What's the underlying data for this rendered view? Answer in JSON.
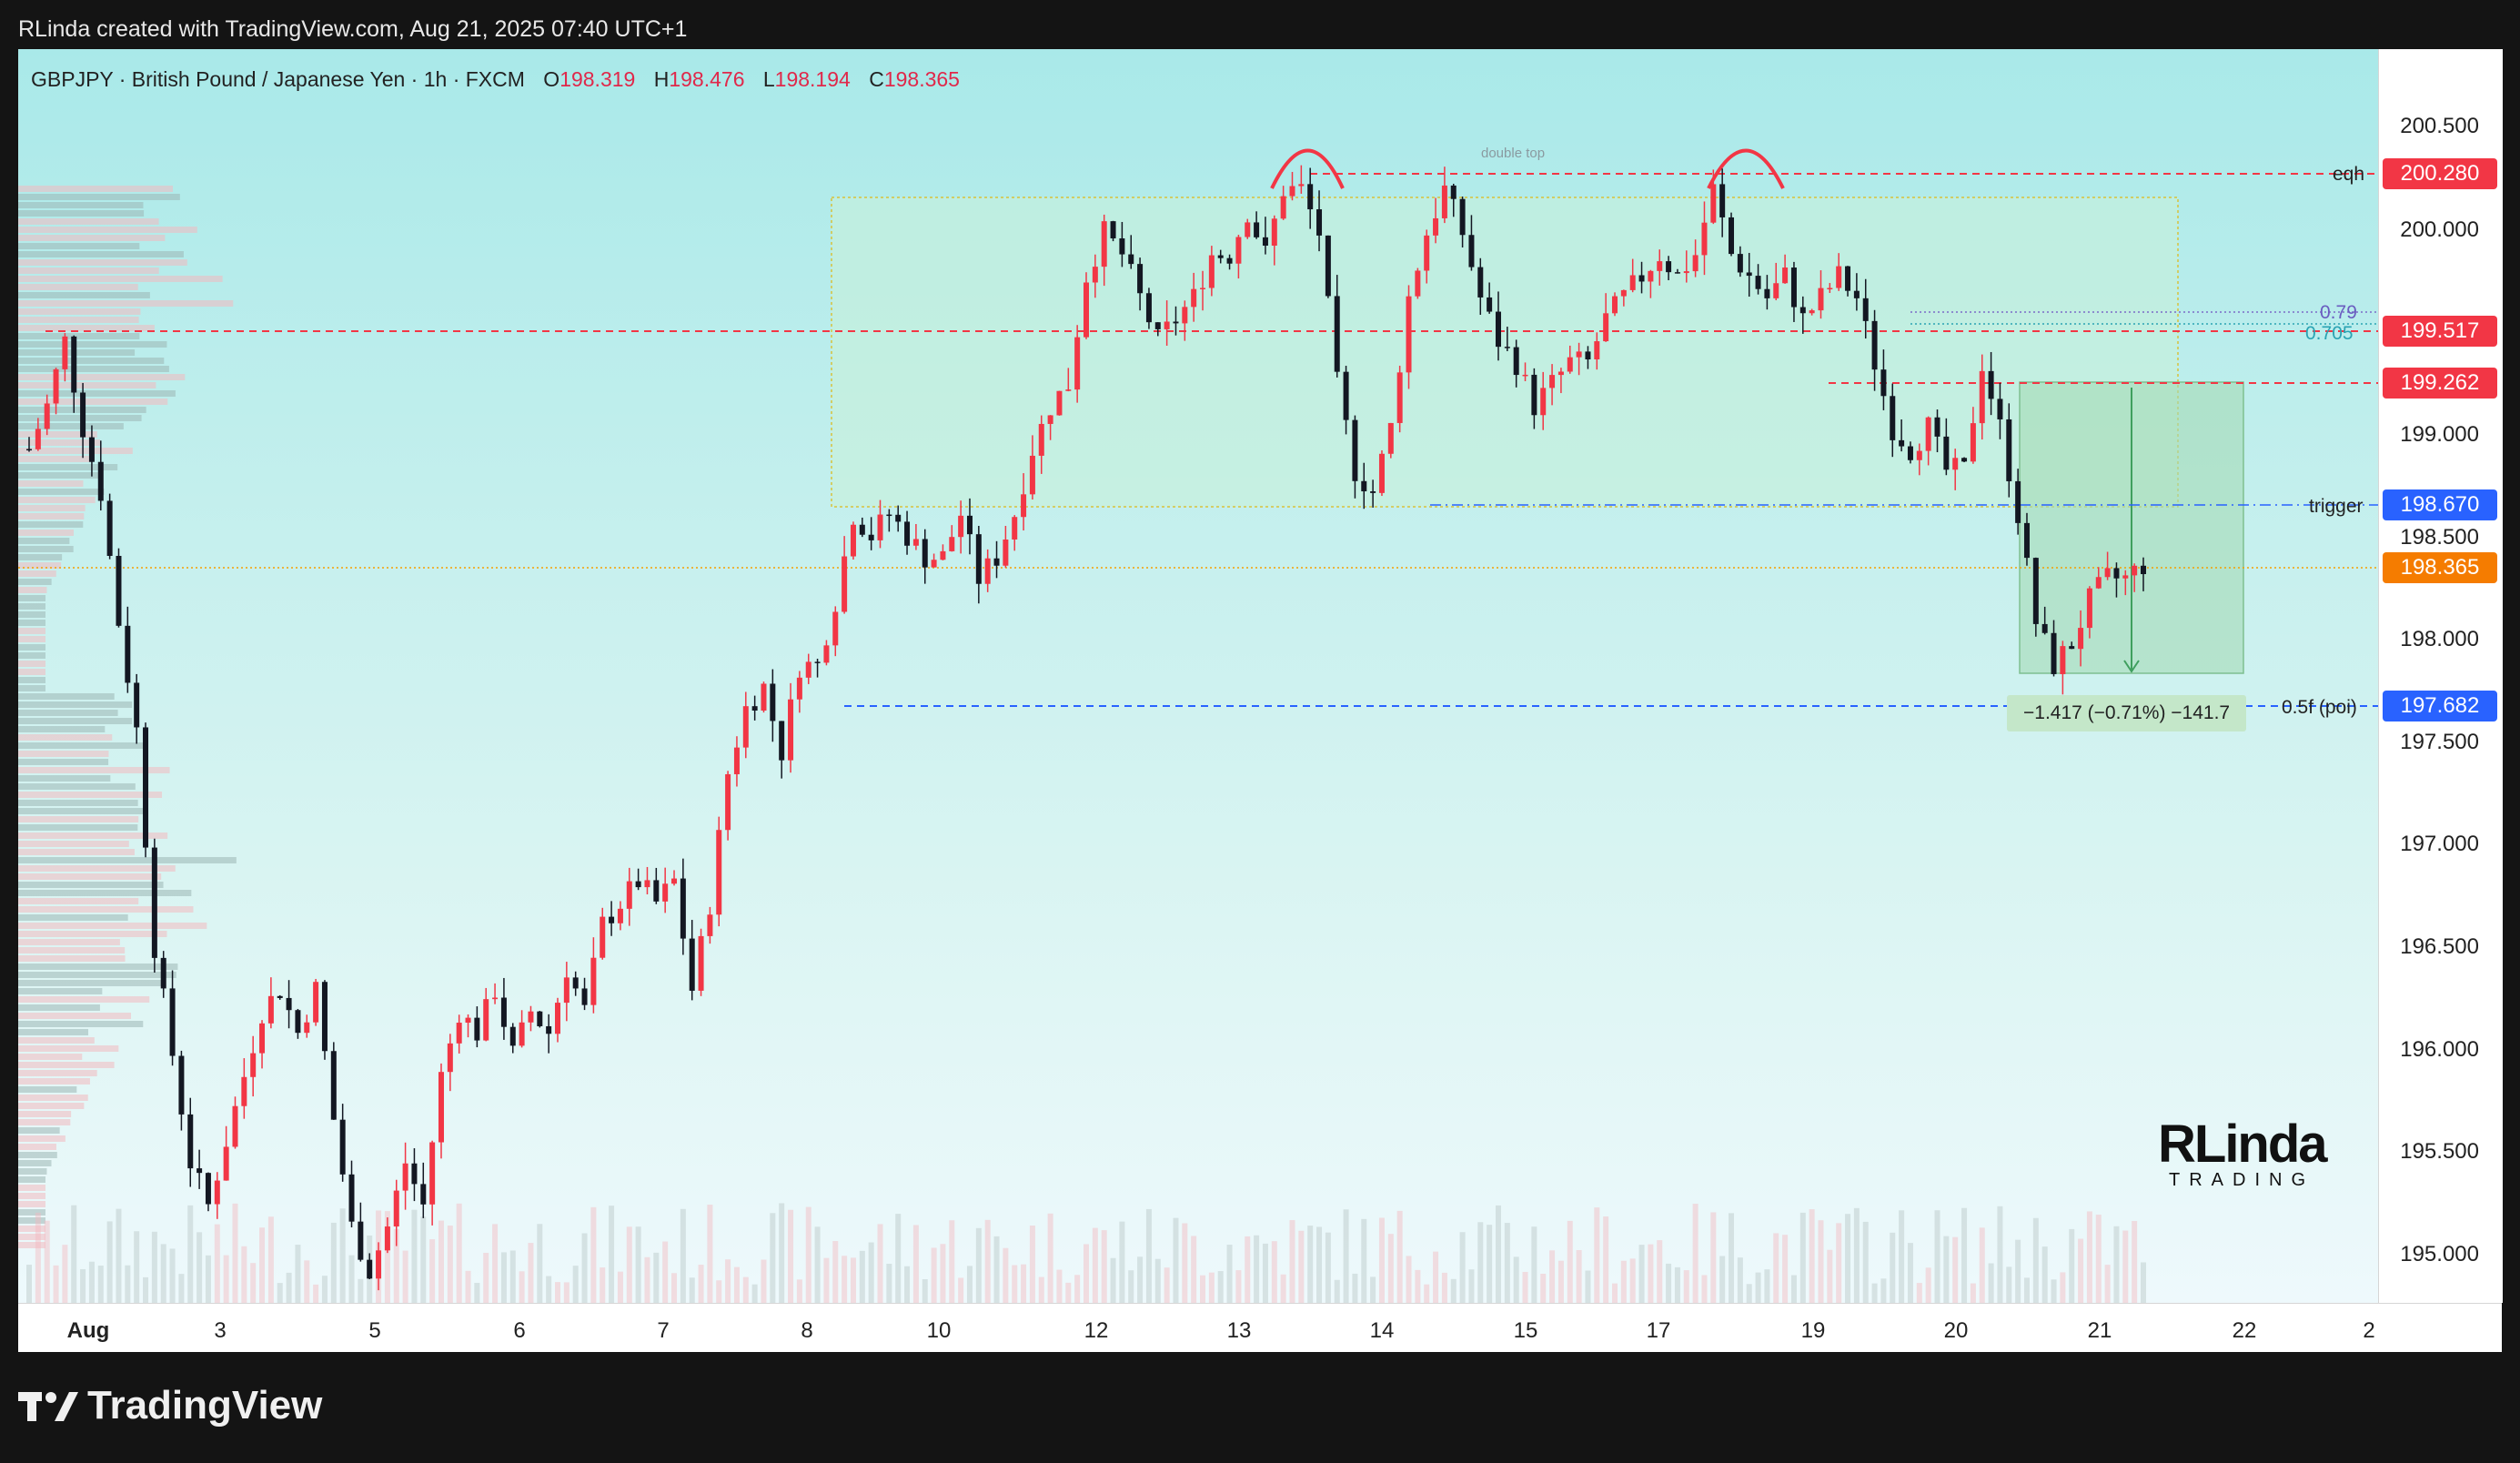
{
  "credit": "RLinda created with TradingView.com, Aug 21, 2025 07:40 UTC+1",
  "legend": {
    "symbol": "GBPJPY · British Pound / Japanese Yen · 1h · FXCM",
    "o_label": "O",
    "o": "198.319",
    "h_label": "H",
    "h": "198.476",
    "l_label": "L",
    "l": "198.194",
    "c_label": "C",
    "c": "198.365"
  },
  "price_axis": {
    "ticks": [
      "200.500",
      "200.000",
      "199.000",
      "198.500",
      "198.000",
      "197.500",
      "197.000",
      "196.500",
      "196.000",
      "195.500",
      "195.000"
    ],
    "tags": [
      {
        "text": "200.280",
        "color": "#f23645"
      },
      {
        "text": "199.517",
        "color": "#f23645"
      },
      {
        "text": "199.262",
        "color": "#f23645"
      },
      {
        "text": "198.670",
        "color": "#2962ff"
      },
      {
        "text": "198.365",
        "color": "#f57c00"
      },
      {
        "text": "197.682",
        "color": "#2962ff"
      }
    ]
  },
  "time_axis": [
    "Aug",
    "3",
    "5",
    "6",
    "7",
    "8",
    "10",
    "12",
    "13",
    "14",
    "15",
    "17",
    "19",
    "20",
    "21",
    "22",
    "2"
  ],
  "line_labels": {
    "eqh": "eqh",
    "fib_079": "0.79",
    "fib_0705": "0.705",
    "trigger": "trigger",
    "poi": "0.5f (poi)",
    "double_top": "double top"
  },
  "position_stats": "−1.417 (−0.71%) −141.7",
  "logo": {
    "big": "RLinda",
    "small": "TRADING"
  },
  "footer": {
    "brand": "TradingView"
  },
  "colors": {
    "bull": "#f23645",
    "bear": "#131722",
    "accent_blue": "#2962ff",
    "accent_orange": "#f57c00"
  },
  "chart_data": {
    "type": "candlestick",
    "symbol": "GBPJPY",
    "timeframe": "1h",
    "ylim": [
      194.95,
      200.75
    ],
    "price_path": [
      [
        0,
        198.9
      ],
      [
        2,
        199.1
      ],
      [
        4,
        199.4
      ],
      [
        6,
        199.0
      ],
      [
        8,
        198.7
      ],
      [
        10,
        198.1
      ],
      [
        12,
        197.6
      ],
      [
        14,
        196.6
      ],
      [
        16,
        196.1
      ],
      [
        18,
        195.6
      ],
      [
        20,
        195.4
      ],
      [
        22,
        195.7
      ],
      [
        24,
        196.0
      ],
      [
        26,
        196.3
      ],
      [
        28,
        196.4
      ],
      [
        30,
        196.2
      ],
      [
        32,
        196.4
      ],
      [
        34,
        195.8
      ],
      [
        36,
        195.3
      ],
      [
        38,
        195.1
      ],
      [
        40,
        195.3
      ],
      [
        42,
        195.6
      ],
      [
        44,
        195.4
      ],
      [
        46,
        196.0
      ],
      [
        48,
        196.3
      ],
      [
        50,
        196.2
      ],
      [
        52,
        196.4
      ],
      [
        54,
        196.1
      ],
      [
        56,
        196.3
      ],
      [
        58,
        196.2
      ],
      [
        60,
        196.5
      ],
      [
        62,
        196.3
      ],
      [
        64,
        196.7
      ],
      [
        66,
        196.8
      ],
      [
        68,
        196.9
      ],
      [
        70,
        196.8
      ],
      [
        72,
        196.9
      ],
      [
        74,
        196.4
      ],
      [
        76,
        196.8
      ],
      [
        78,
        197.4
      ],
      [
        80,
        197.7
      ],
      [
        82,
        197.8
      ],
      [
        84,
        197.5
      ],
      [
        86,
        197.9
      ],
      [
        88,
        197.9
      ],
      [
        90,
        198.2
      ],
      [
        92,
        198.6
      ],
      [
        94,
        198.5
      ],
      [
        96,
        198.6
      ],
      [
        98,
        198.5
      ],
      [
        100,
        198.4
      ],
      [
        102,
        198.4
      ],
      [
        104,
        198.6
      ],
      [
        106,
        198.3
      ],
      [
        108,
        198.4
      ],
      [
        110,
        198.6
      ],
      [
        112,
        198.9
      ],
      [
        114,
        199.1
      ],
      [
        116,
        199.2
      ],
      [
        118,
        199.7
      ],
      [
        120,
        199.9
      ],
      [
        122,
        199.8
      ],
      [
        124,
        199.6
      ],
      [
        126,
        199.4
      ],
      [
        128,
        199.5
      ],
      [
        130,
        199.6
      ],
      [
        132,
        199.8
      ],
      [
        134,
        199.8
      ],
      [
        136,
        200.0
      ],
      [
        138,
        199.8
      ],
      [
        140,
        200.1
      ],
      [
        142,
        200.1
      ],
      [
        144,
        199.9
      ],
      [
        146,
        199.2
      ],
      [
        148,
        198.8
      ],
      [
        150,
        198.7
      ],
      [
        152,
        199.0
      ],
      [
        154,
        199.6
      ],
      [
        156,
        199.9
      ],
      [
        158,
        200.1
      ],
      [
        160,
        199.9
      ],
      [
        162,
        199.6
      ],
      [
        164,
        199.4
      ],
      [
        166,
        199.3
      ],
      [
        168,
        199.1
      ],
      [
        170,
        199.2
      ],
      [
        172,
        199.3
      ],
      [
        174,
        199.3
      ],
      [
        176,
        199.5
      ],
      [
        178,
        199.6
      ],
      [
        180,
        199.7
      ],
      [
        182,
        199.8
      ],
      [
        184,
        199.7
      ],
      [
        186,
        199.8
      ],
      [
        188,
        200.1
      ],
      [
        190,
        199.8
      ],
      [
        192,
        199.7
      ],
      [
        194,
        199.6
      ],
      [
        196,
        199.7
      ],
      [
        198,
        199.5
      ],
      [
        200,
        199.6
      ],
      [
        202,
        199.7
      ],
      [
        204,
        199.6
      ],
      [
        206,
        199.3
      ],
      [
        208,
        199.0
      ],
      [
        210,
        198.9
      ],
      [
        212,
        199.0
      ],
      [
        214,
        198.8
      ],
      [
        216,
        198.8
      ],
      [
        218,
        199.3
      ],
      [
        220,
        199.0
      ],
      [
        222,
        198.6
      ],
      [
        224,
        198.1
      ],
      [
        226,
        197.9
      ],
      [
        228,
        198.0
      ],
      [
        230,
        198.2
      ],
      [
        232,
        198.3
      ],
      [
        234,
        198.3
      ],
      [
        236,
        198.365
      ]
    ],
    "levels": [
      {
        "name": "eqh",
        "price": 200.28
      },
      {
        "name": "0.79",
        "price": 199.6
      },
      {
        "name": "0.705",
        "price": 199.517
      },
      {
        "name": "trigger",
        "price": 198.67
      },
      {
        "name": "0.5f (poi)",
        "price": 197.682
      }
    ],
    "current_price": 198.365
  }
}
